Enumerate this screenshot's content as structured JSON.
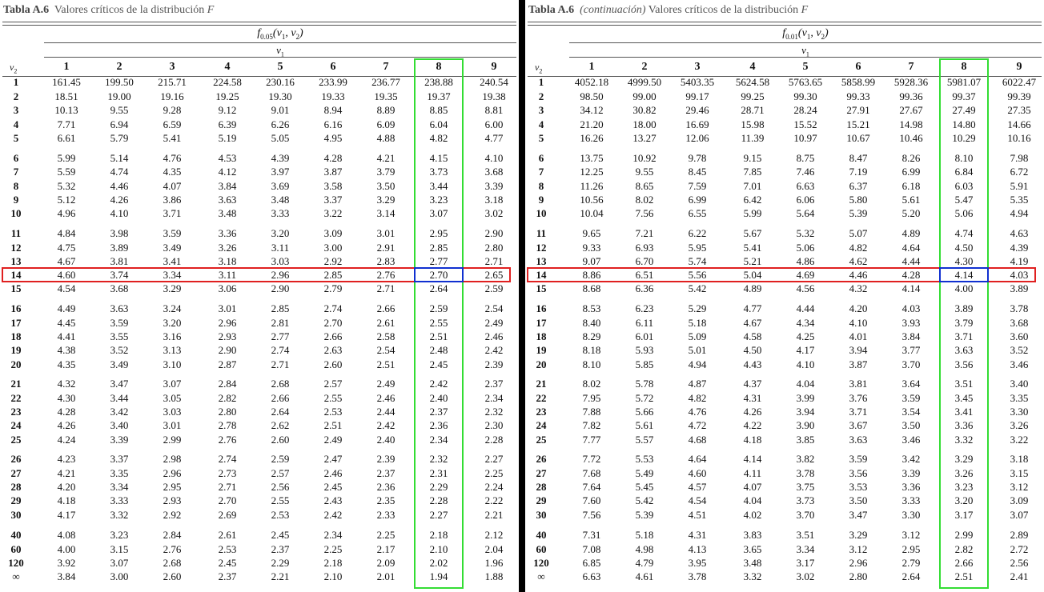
{
  "tables": [
    {
      "caption_label": "Tabla A.6",
      "caption_cont": "",
      "caption_text": "Valores críticos de la distribución",
      "caption_var": "F",
      "f_alpha": "0.05",
      "v1_label": "v",
      "v2_label": "v",
      "col_headers": [
        "1",
        "2",
        "3",
        "4",
        "5",
        "6",
        "7",
        "8",
        "9"
      ],
      "row_labels": [
        "1",
        "2",
        "3",
        "4",
        "5",
        "6",
        "7",
        "8",
        "9",
        "10",
        "11",
        "12",
        "13",
        "14",
        "15",
        "16",
        "17",
        "18",
        "19",
        "20",
        "21",
        "22",
        "23",
        "24",
        "25",
        "26",
        "27",
        "28",
        "29",
        "30",
        "40",
        "60",
        "120",
        "∞"
      ],
      "rows": [
        [
          "161.45",
          "199.50",
          "215.71",
          "224.58",
          "230.16",
          "233.99",
          "236.77",
          "238.88",
          "240.54"
        ],
        [
          "18.51",
          "19.00",
          "19.16",
          "19.25",
          "19.30",
          "19.33",
          "19.35",
          "19.37",
          "19.38"
        ],
        [
          "10.13",
          "9.55",
          "9.28",
          "9.12",
          "9.01",
          "8.94",
          "8.89",
          "8.85",
          "8.81"
        ],
        [
          "7.71",
          "6.94",
          "6.59",
          "6.39",
          "6.26",
          "6.16",
          "6.09",
          "6.04",
          "6.00"
        ],
        [
          "6.61",
          "5.79",
          "5.41",
          "5.19",
          "5.05",
          "4.95",
          "4.88",
          "4.82",
          "4.77"
        ],
        [
          "5.99",
          "5.14",
          "4.76",
          "4.53",
          "4.39",
          "4.28",
          "4.21",
          "4.15",
          "4.10"
        ],
        [
          "5.59",
          "4.74",
          "4.35",
          "4.12",
          "3.97",
          "3.87",
          "3.79",
          "3.73",
          "3.68"
        ],
        [
          "5.32",
          "4.46",
          "4.07",
          "3.84",
          "3.69",
          "3.58",
          "3.50",
          "3.44",
          "3.39"
        ],
        [
          "5.12",
          "4.26",
          "3.86",
          "3.63",
          "3.48",
          "3.37",
          "3.29",
          "3.23",
          "3.18"
        ],
        [
          "4.96",
          "4.10",
          "3.71",
          "3.48",
          "3.33",
          "3.22",
          "3.14",
          "3.07",
          "3.02"
        ],
        [
          "4.84",
          "3.98",
          "3.59",
          "3.36",
          "3.20",
          "3.09",
          "3.01",
          "2.95",
          "2.90"
        ],
        [
          "4.75",
          "3.89",
          "3.49",
          "3.26",
          "3.11",
          "3.00",
          "2.91",
          "2.85",
          "2.80"
        ],
        [
          "4.67",
          "3.81",
          "3.41",
          "3.18",
          "3.03",
          "2.92",
          "2.83",
          "2.77",
          "2.71"
        ],
        [
          "4.60",
          "3.74",
          "3.34",
          "3.11",
          "2.96",
          "2.85",
          "2.76",
          "2.70",
          "2.65"
        ],
        [
          "4.54",
          "3.68",
          "3.29",
          "3.06",
          "2.90",
          "2.79",
          "2.71",
          "2.64",
          "2.59"
        ],
        [
          "4.49",
          "3.63",
          "3.24",
          "3.01",
          "2.85",
          "2.74",
          "2.66",
          "2.59",
          "2.54"
        ],
        [
          "4.45",
          "3.59",
          "3.20",
          "2.96",
          "2.81",
          "2.70",
          "2.61",
          "2.55",
          "2.49"
        ],
        [
          "4.41",
          "3.55",
          "3.16",
          "2.93",
          "2.77",
          "2.66",
          "2.58",
          "2.51",
          "2.46"
        ],
        [
          "4.38",
          "3.52",
          "3.13",
          "2.90",
          "2.74",
          "2.63",
          "2.54",
          "2.48",
          "2.42"
        ],
        [
          "4.35",
          "3.49",
          "3.10",
          "2.87",
          "2.71",
          "2.60",
          "2.51",
          "2.45",
          "2.39"
        ],
        [
          "4.32",
          "3.47",
          "3.07",
          "2.84",
          "2.68",
          "2.57",
          "2.49",
          "2.42",
          "2.37"
        ],
        [
          "4.30",
          "3.44",
          "3.05",
          "2.82",
          "2.66",
          "2.55",
          "2.46",
          "2.40",
          "2.34"
        ],
        [
          "4.28",
          "3.42",
          "3.03",
          "2.80",
          "2.64",
          "2.53",
          "2.44",
          "2.37",
          "2.32"
        ],
        [
          "4.26",
          "3.40",
          "3.01",
          "2.78",
          "2.62",
          "2.51",
          "2.42",
          "2.36",
          "2.30"
        ],
        [
          "4.24",
          "3.39",
          "2.99",
          "2.76",
          "2.60",
          "2.49",
          "2.40",
          "2.34",
          "2.28"
        ],
        [
          "4.23",
          "3.37",
          "2.98",
          "2.74",
          "2.59",
          "2.47",
          "2.39",
          "2.32",
          "2.27"
        ],
        [
          "4.21",
          "3.35",
          "2.96",
          "2.73",
          "2.57",
          "2.46",
          "2.37",
          "2.31",
          "2.25"
        ],
        [
          "4.20",
          "3.34",
          "2.95",
          "2.71",
          "2.56",
          "2.45",
          "2.36",
          "2.29",
          "2.24"
        ],
        [
          "4.18",
          "3.33",
          "2.93",
          "2.70",
          "2.55",
          "2.43",
          "2.35",
          "2.28",
          "2.22"
        ],
        [
          "4.17",
          "3.32",
          "2.92",
          "2.69",
          "2.53",
          "2.42",
          "2.33",
          "2.27",
          "2.21"
        ],
        [
          "4.08",
          "3.23",
          "2.84",
          "2.61",
          "2.45",
          "2.34",
          "2.25",
          "2.18",
          "2.12"
        ],
        [
          "4.00",
          "3.15",
          "2.76",
          "2.53",
          "2.37",
          "2.25",
          "2.17",
          "2.10",
          "2.04"
        ],
        [
          "3.92",
          "3.07",
          "2.68",
          "2.45",
          "2.29",
          "2.18",
          "2.09",
          "2.02",
          "1.96"
        ],
        [
          "3.84",
          "3.00",
          "2.60",
          "2.37",
          "2.21",
          "2.10",
          "2.01",
          "1.94",
          "1.88"
        ]
      ],
      "highlight_col": "8",
      "highlight_row": "14",
      "highlight_colors": {
        "column": "#33dd33",
        "row": "#e02020",
        "cell": "#1030d0"
      }
    },
    {
      "caption_label": "Tabla A.6",
      "caption_cont": "(continuación)",
      "caption_text": "Valores críticos de la distribución",
      "caption_var": "F",
      "f_alpha": "0.01",
      "v1_label": "v",
      "v2_label": "v",
      "col_headers": [
        "1",
        "2",
        "3",
        "4",
        "5",
        "6",
        "7",
        "8",
        "9"
      ],
      "row_labels": [
        "1",
        "2",
        "3",
        "4",
        "5",
        "6",
        "7",
        "8",
        "9",
        "10",
        "11",
        "12",
        "13",
        "14",
        "15",
        "16",
        "17",
        "18",
        "19",
        "20",
        "21",
        "22",
        "23",
        "24",
        "25",
        "26",
        "27",
        "28",
        "29",
        "30",
        "40",
        "60",
        "120",
        "∞"
      ],
      "rows": [
        [
          "4052.18",
          "4999.50",
          "5403.35",
          "5624.58",
          "5763.65",
          "5858.99",
          "5928.36",
          "5981.07",
          "6022.47"
        ],
        [
          "98.50",
          "99.00",
          "99.17",
          "99.25",
          "99.30",
          "99.33",
          "99.36",
          "99.37",
          "99.39"
        ],
        [
          "34.12",
          "30.82",
          "29.46",
          "28.71",
          "28.24",
          "27.91",
          "27.67",
          "27.49",
          "27.35"
        ],
        [
          "21.20",
          "18.00",
          "16.69",
          "15.98",
          "15.52",
          "15.21",
          "14.98",
          "14.80",
          "14.66"
        ],
        [
          "16.26",
          "13.27",
          "12.06",
          "11.39",
          "10.97",
          "10.67",
          "10.46",
          "10.29",
          "10.16"
        ],
        [
          "13.75",
          "10.92",
          "9.78",
          "9.15",
          "8.75",
          "8.47",
          "8.26",
          "8.10",
          "7.98"
        ],
        [
          "12.25",
          "9.55",
          "8.45",
          "7.85",
          "7.46",
          "7.19",
          "6.99",
          "6.84",
          "6.72"
        ],
        [
          "11.26",
          "8.65",
          "7.59",
          "7.01",
          "6.63",
          "6.37",
          "6.18",
          "6.03",
          "5.91"
        ],
        [
          "10.56",
          "8.02",
          "6.99",
          "6.42",
          "6.06",
          "5.80",
          "5.61",
          "5.47",
          "5.35"
        ],
        [
          "10.04",
          "7.56",
          "6.55",
          "5.99",
          "5.64",
          "5.39",
          "5.20",
          "5.06",
          "4.94"
        ],
        [
          "9.65",
          "7.21",
          "6.22",
          "5.67",
          "5.32",
          "5.07",
          "4.89",
          "4.74",
          "4.63"
        ],
        [
          "9.33",
          "6.93",
          "5.95",
          "5.41",
          "5.06",
          "4.82",
          "4.64",
          "4.50",
          "4.39"
        ],
        [
          "9.07",
          "6.70",
          "5.74",
          "5.21",
          "4.86",
          "4.62",
          "4.44",
          "4.30",
          "4.19"
        ],
        [
          "8.86",
          "6.51",
          "5.56",
          "5.04",
          "4.69",
          "4.46",
          "4.28",
          "4.14",
          "4.03"
        ],
        [
          "8.68",
          "6.36",
          "5.42",
          "4.89",
          "4.56",
          "4.32",
          "4.14",
          "4.00",
          "3.89"
        ],
        [
          "8.53",
          "6.23",
          "5.29",
          "4.77",
          "4.44",
          "4.20",
          "4.03",
          "3.89",
          "3.78"
        ],
        [
          "8.40",
          "6.11",
          "5.18",
          "4.67",
          "4.34",
          "4.10",
          "3.93",
          "3.79",
          "3.68"
        ],
        [
          "8.29",
          "6.01",
          "5.09",
          "4.58",
          "4.25",
          "4.01",
          "3.84",
          "3.71",
          "3.60"
        ],
        [
          "8.18",
          "5.93",
          "5.01",
          "4.50",
          "4.17",
          "3.94",
          "3.77",
          "3.63",
          "3.52"
        ],
        [
          "8.10",
          "5.85",
          "4.94",
          "4.43",
          "4.10",
          "3.87",
          "3.70",
          "3.56",
          "3.46"
        ],
        [
          "8.02",
          "5.78",
          "4.87",
          "4.37",
          "4.04",
          "3.81",
          "3.64",
          "3.51",
          "3.40"
        ],
        [
          "7.95",
          "5.72",
          "4.82",
          "4.31",
          "3.99",
          "3.76",
          "3.59",
          "3.45",
          "3.35"
        ],
        [
          "7.88",
          "5.66",
          "4.76",
          "4.26",
          "3.94",
          "3.71",
          "3.54",
          "3.41",
          "3.30"
        ],
        [
          "7.82",
          "5.61",
          "4.72",
          "4.22",
          "3.90",
          "3.67",
          "3.50",
          "3.36",
          "3.26"
        ],
        [
          "7.77",
          "5.57",
          "4.68",
          "4.18",
          "3.85",
          "3.63",
          "3.46",
          "3.32",
          "3.22"
        ],
        [
          "7.72",
          "5.53",
          "4.64",
          "4.14",
          "3.82",
          "3.59",
          "3.42",
          "3.29",
          "3.18"
        ],
        [
          "7.68",
          "5.49",
          "4.60",
          "4.11",
          "3.78",
          "3.56",
          "3.39",
          "3.26",
          "3.15"
        ],
        [
          "7.64",
          "5.45",
          "4.57",
          "4.07",
          "3.75",
          "3.53",
          "3.36",
          "3.23",
          "3.12"
        ],
        [
          "7.60",
          "5.42",
          "4.54",
          "4.04",
          "3.73",
          "3.50",
          "3.33",
          "3.20",
          "3.09"
        ],
        [
          "7.56",
          "5.39",
          "4.51",
          "4.02",
          "3.70",
          "3.47",
          "3.30",
          "3.17",
          "3.07"
        ],
        [
          "7.31",
          "5.18",
          "4.31",
          "3.83",
          "3.51",
          "3.29",
          "3.12",
          "2.99",
          "2.89"
        ],
        [
          "7.08",
          "4.98",
          "4.13",
          "3.65",
          "3.34",
          "3.12",
          "2.95",
          "2.82",
          "2.72"
        ],
        [
          "6.85",
          "4.79",
          "3.95",
          "3.48",
          "3.17",
          "2.96",
          "2.79",
          "2.66",
          "2.56"
        ],
        [
          "6.63",
          "4.61",
          "3.78",
          "3.32",
          "3.02",
          "2.80",
          "2.64",
          "2.51",
          "2.41"
        ]
      ],
      "highlight_col": "8",
      "highlight_row": "14",
      "highlight_colors": {
        "column": "#33dd33",
        "row": "#e02020",
        "cell": "#1030d0"
      }
    }
  ]
}
